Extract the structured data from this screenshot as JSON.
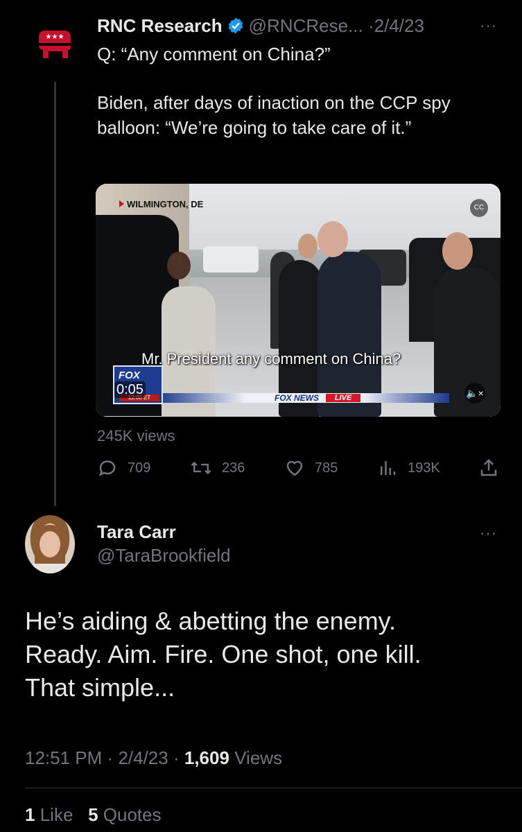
{
  "parent_tweet": {
    "name": "RNC Research",
    "handle": "@RNCRese...",
    "separator": "·",
    "date": "2/4/23",
    "more": "···",
    "text_line1": "Q: “Any comment on China?”",
    "text_para2": "Biden, after days of inaction on the CCP spy balloon: “We’re going to take care of it.”",
    "video": {
      "location": "WILMINGTON, DE",
      "caption": "Mr. President any comment on China?",
      "duration": "0:05",
      "fox_logo": "FOX",
      "fox_time": "12:00 ET",
      "fox_news": "FOX NEWS",
      "live": "LIVE",
      "cc_label": "CC"
    },
    "views": "245K views",
    "actions": {
      "replies": "709",
      "retweets": "236",
      "likes": "785",
      "views": "193K"
    }
  },
  "reply": {
    "name": "Tara Carr",
    "handle": "@TaraBrookfield",
    "more": "···",
    "text_lines": [
      "He’s aiding & abetting the enemy.",
      "Ready. Aim. Fire. One shot, one kill.",
      "That simple..."
    ],
    "time": "12:51 PM",
    "sep1": "·",
    "date": "2/4/23",
    "sep2": "·",
    "view_count": "1,609",
    "views_label": "Views",
    "like_count": "1",
    "like_label": "Like",
    "quote_count": "5",
    "quote_label": "Quotes"
  },
  "colors": {
    "background": "#000000",
    "text": "#e7e9ea",
    "muted": "#71767b",
    "verified": "#1d9bf0",
    "rnc_red": "#c8102e"
  }
}
